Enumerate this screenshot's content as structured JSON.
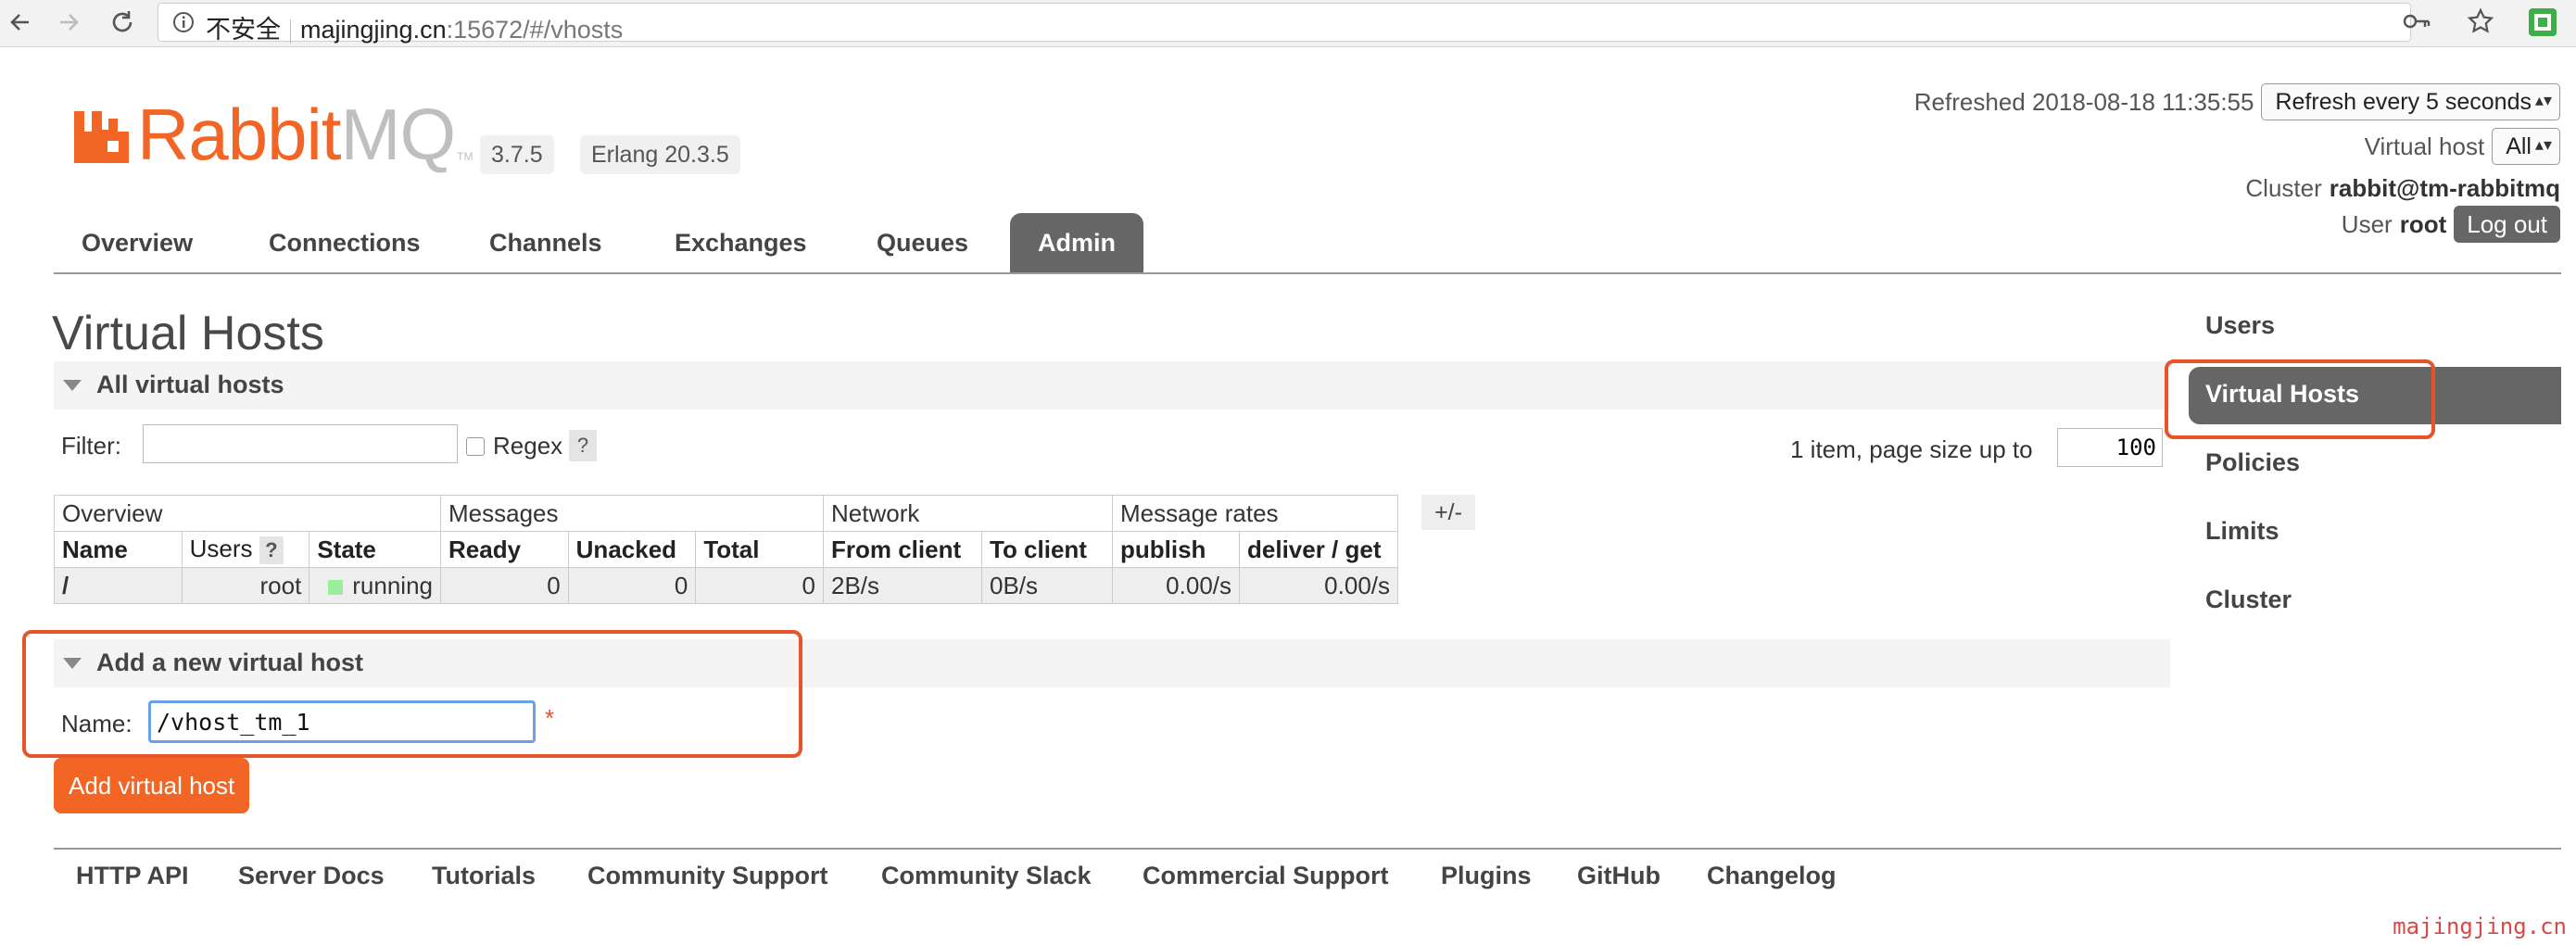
{
  "browser": {
    "insecure_label": "不安全",
    "url_host": "majingjing.cn",
    "url_rest": ":15672/#/vhosts"
  },
  "header": {
    "logo_brand": "Rabbit",
    "logo_mq": "MQ",
    "logo_tm": "TM",
    "version": "3.7.5",
    "erlang": "Erlang 20.3.5",
    "refreshed_label": "Refreshed 2018-08-18 11:35:55",
    "refresh_select": "Refresh every 5 seconds",
    "vhost_label": "Virtual host",
    "vhost_select": "All",
    "cluster_label": "Cluster",
    "cluster_name": "rabbit@tm-rabbitmq",
    "user_label": "User",
    "user_name": "root",
    "logout_label": "Log out"
  },
  "tabs": [
    {
      "label": "Overview"
    },
    {
      "label": "Connections"
    },
    {
      "label": "Channels"
    },
    {
      "label": "Exchanges"
    },
    {
      "label": "Queues"
    },
    {
      "label": "Admin",
      "active": true
    }
  ],
  "page": {
    "title": "Virtual Hosts",
    "all_section": "All virtual hosts",
    "filter_label": "Filter:",
    "filter_value": "",
    "regex_label": "Regex",
    "regex_checked": false,
    "help_symbol": "?",
    "page_info": "1 item, page size up to",
    "page_size": "100"
  },
  "table": {
    "groups": [
      "Overview",
      "Messages",
      "Network",
      "Message rates"
    ],
    "columns": [
      "Name",
      "Users",
      "State",
      "Ready",
      "Unacked",
      "Total",
      "From client",
      "To client",
      "publish",
      "deliver / get"
    ],
    "rows": [
      {
        "name": "/",
        "users": "root",
        "state": "running",
        "ready": "0",
        "unacked": "0",
        "total": "0",
        "from_client": "2B/s",
        "to_client": "0B/s",
        "publish": "0.00/s",
        "deliver_get": "0.00/s"
      }
    ],
    "plus_minus": "+/-"
  },
  "add_host": {
    "section": "Add a new virtual host",
    "name_label": "Name:",
    "name_value": "/vhost_tm_1",
    "required_mark": "*",
    "button_label": "Add virtual host"
  },
  "sidebar": {
    "items": [
      {
        "label": "Users"
      },
      {
        "label": "Virtual Hosts",
        "active": true
      },
      {
        "label": "Policies"
      },
      {
        "label": "Limits"
      },
      {
        "label": "Cluster"
      }
    ]
  },
  "footer": {
    "links": [
      "HTTP API",
      "Server Docs",
      "Tutorials",
      "Community Support",
      "Community Slack",
      "Commercial Support",
      "Plugins",
      "GitHub",
      "Changelog"
    ]
  },
  "watermark": "majingjing.cn",
  "colors": {
    "brand_orange": "#f26524",
    "active_tab": "#666666",
    "highlight_red": "#e8542a",
    "running_green": "#99ee99",
    "input_focus": "#6aa0e8"
  }
}
